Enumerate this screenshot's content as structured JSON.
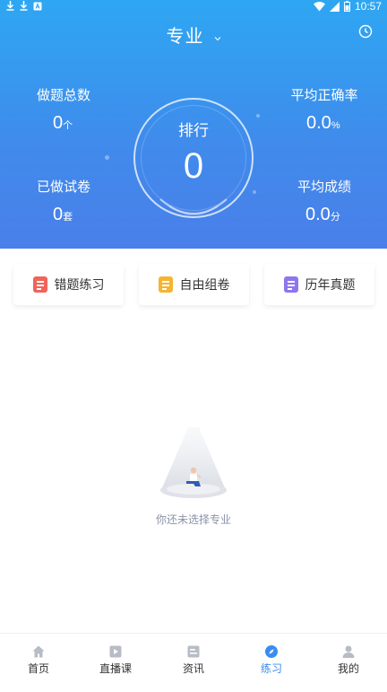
{
  "status_bar": {
    "time": "10:57"
  },
  "header": {
    "title": "专业"
  },
  "stats": {
    "total_questions": {
      "label": "做题总数",
      "value": "0",
      "unit": "个"
    },
    "avg_accuracy": {
      "label": "平均正确率",
      "value": "0.0",
      "unit": "%"
    },
    "papers_done": {
      "label": "已做试卷",
      "value": "0",
      "unit": "套"
    },
    "avg_score": {
      "label": "平均成绩",
      "value": "0.0",
      "unit": "分"
    }
  },
  "rank": {
    "label": "排行",
    "value": "0"
  },
  "actions": [
    {
      "label": "错题练习",
      "icon": "wrong-questions-icon",
      "color": "#f0645a"
    },
    {
      "label": "自由组卷",
      "icon": "free-paper-icon",
      "color": "#f6b52e"
    },
    {
      "label": "历年真题",
      "icon": "past-exams-icon",
      "color": "#8f76ee"
    }
  ],
  "empty_state": {
    "message": "你还未选择专业"
  },
  "tabs": [
    {
      "label": "首页",
      "icon": "home-icon",
      "active": false
    },
    {
      "label": "直播课",
      "icon": "live-class-icon",
      "active": false
    },
    {
      "label": "资讯",
      "icon": "news-icon",
      "active": false
    },
    {
      "label": "练习",
      "icon": "practice-compass-icon",
      "active": true
    },
    {
      "label": "我的",
      "icon": "profile-icon",
      "active": false
    }
  ],
  "colors": {
    "accent": "#3b8cf0",
    "hero_top": "#2ea7f2",
    "hero_bottom": "#4a7fe9",
    "inactive_icon": "#b7bcc6"
  }
}
